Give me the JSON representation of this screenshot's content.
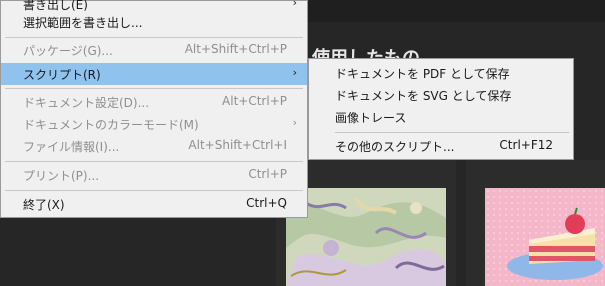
{
  "background": {
    "heading_fragment": "使用したもの"
  },
  "menu": {
    "items": [
      {
        "label": "書き出し(E)",
        "shortcut": "",
        "has_submenu": true,
        "enabled": true
      },
      {
        "label": "選択範囲を書き出し...",
        "shortcut": "",
        "has_submenu": false,
        "enabled": true
      },
      {
        "label": "パッケージ(G)...",
        "shortcut": "Alt+Shift+Ctrl+P",
        "has_submenu": false,
        "enabled": false
      },
      {
        "label": "スクリプト(R)",
        "shortcut": "",
        "has_submenu": true,
        "enabled": true,
        "highlighted": true
      },
      {
        "label": "ドキュメント設定(D)...",
        "shortcut": "Alt+Ctrl+P",
        "has_submenu": false,
        "enabled": false
      },
      {
        "label": "ドキュメントのカラーモード(M)",
        "shortcut": "",
        "has_submenu": true,
        "enabled": false
      },
      {
        "label": "ファイル情報(I)...",
        "shortcut": "Alt+Shift+Ctrl+I",
        "has_submenu": false,
        "enabled": false
      },
      {
        "label": "プリント(P)...",
        "shortcut": "Ctrl+P",
        "has_submenu": false,
        "enabled": false
      },
      {
        "label": "終了(X)",
        "shortcut": "Ctrl+Q",
        "has_submenu": false,
        "enabled": true
      }
    ],
    "arrow_glyph": "›"
  },
  "submenu": {
    "items": [
      {
        "label": "ドキュメントを PDF として保存",
        "shortcut": ""
      },
      {
        "label": "ドキュメントを SVG として保存",
        "shortcut": ""
      },
      {
        "label": "画像トレース",
        "shortcut": ""
      },
      {
        "label": "その他のスクリプト...",
        "shortcut": "Ctrl+F12"
      }
    ]
  },
  "colors": {
    "highlight": "#8fc3ee",
    "menu_bg": "#f0f0f0",
    "disabled_text": "#8f8f8f",
    "app_bg": "#262626"
  }
}
